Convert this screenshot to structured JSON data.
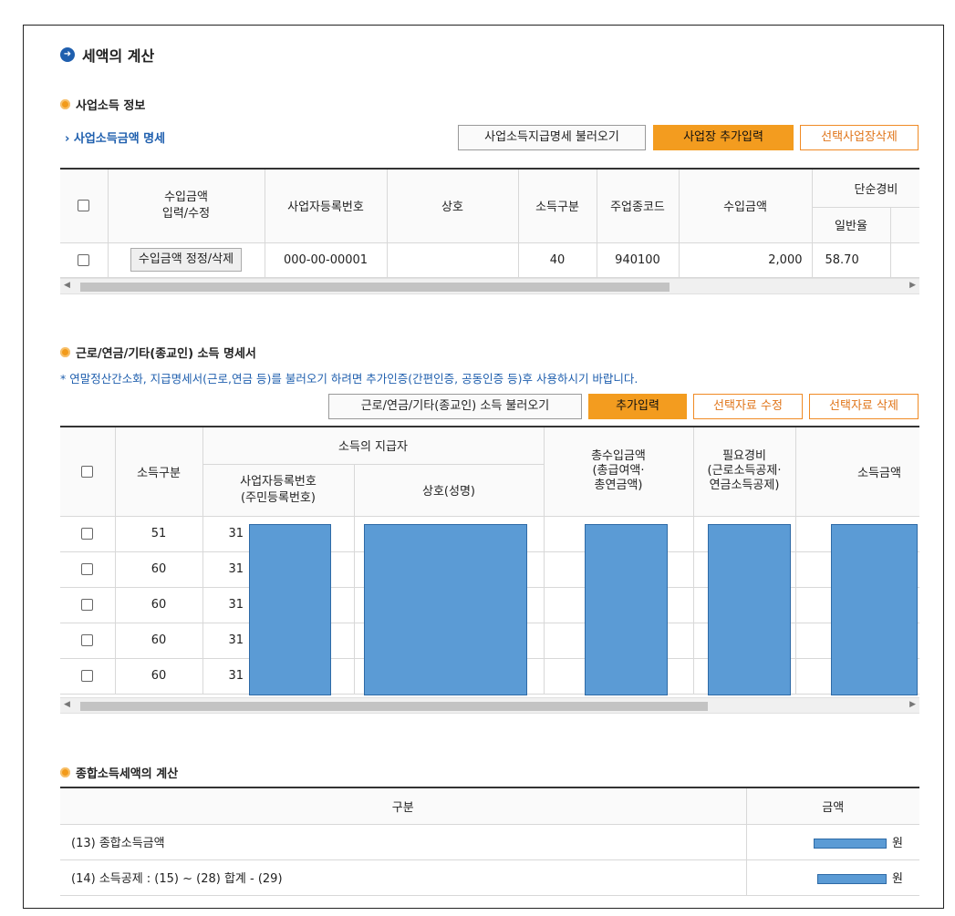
{
  "main_title": "세액의 계산",
  "business_income": {
    "section_title": "사업소득 정보",
    "link": "사업소득금액 명세",
    "buttons": {
      "load": "사업소득지급명세 불러오기",
      "add": "사업장 추가입력",
      "delete": "선택사업장삭제"
    },
    "headers": {
      "edit": "수입금액\n입력/수정",
      "reg_no": "사업자등록번호",
      "company": "상호",
      "income_type": "소득구분",
      "industry_code": "주업종코드",
      "revenue": "수입금액",
      "simple_expense": "단순경비",
      "general_rate": "일반율"
    },
    "rows": [
      {
        "edit_label": "수입금액 정정/삭제",
        "reg_no": "000-00-00001",
        "company": "",
        "income_type": "40",
        "industry_code": "940100",
        "revenue": "2,000",
        "rate": "58.70"
      }
    ]
  },
  "other_income": {
    "section_title": "근로/연금/기타(종교인) 소득 명세서",
    "note": "* 연말정산간소화, 지급명세서(근로,연금 등)를 불러오기 하려면 추가인증(간편인증, 공동인증 등)후 사용하시기 바랍니다.",
    "buttons": {
      "load": "근로/연금/기타(종교인) 소득 불러오기",
      "add": "추가입력",
      "edit": "선택자료 수정",
      "delete": "선택자료 삭제"
    },
    "headers": {
      "income_type": "소득구분",
      "payer": "소득의 지급자",
      "reg_no": "사업자등록번호\n(주민등록번호)",
      "name": "상호(성명)",
      "total_income": "총수입금액\n(총급여액·\n총연금액)",
      "expense": "필요경비\n(근로소득공제·\n연금소득공제)",
      "income_amount": "소득금액"
    },
    "rows": [
      {
        "income_type": "51",
        "reg_no_prefix": "31"
      },
      {
        "income_type": "60",
        "reg_no_prefix": "31"
      },
      {
        "income_type": "60",
        "reg_no_prefix": "31"
      },
      {
        "income_type": "60",
        "reg_no_prefix": "31"
      },
      {
        "income_type": "60",
        "reg_no_prefix": "31"
      }
    ]
  },
  "tax_calc": {
    "section_title": "종합소득세액의 계산",
    "headers": {
      "category": "구분",
      "amount": "금액"
    },
    "rows": [
      {
        "label": "(13) 종합소득금액",
        "unit": "원"
      },
      {
        "label": "(14) 소득공제 : (15) ~ (28) 합계 - (29)",
        "unit": "원"
      }
    ]
  },
  "colors": {
    "accent_orange": "#f39c1f",
    "link_blue": "#1f5fae",
    "redaction_blue": "#5b9bd5"
  }
}
